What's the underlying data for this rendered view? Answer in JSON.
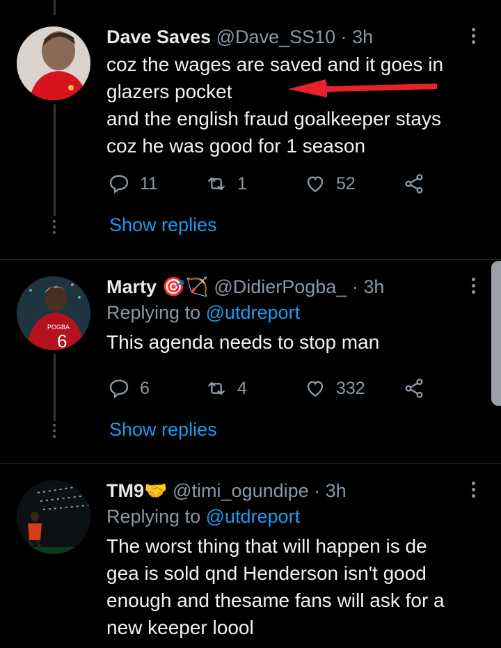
{
  "tweets": [
    {
      "name": "Dave Saves",
      "name_emoji": "",
      "handle": "@Dave_SS10 · 3h",
      "replying_prefix": "",
      "replying_mention": "",
      "text": "coz the wages are saved and it goes in\nglazers pocket\nand the english fraud goalkeeper stays\ncoz he was good for 1 season",
      "replies": "11",
      "retweets": "1",
      "likes": "52",
      "show_replies": "Show replies"
    },
    {
      "name": "Marty",
      "name_emoji": "🎯🏹",
      "handle": "@DidierPogba_ · 3h",
      "replying_prefix": "Replying to ",
      "replying_mention": "@utdreport",
      "text": "This agenda needs to stop man",
      "replies": "6",
      "retweets": "4",
      "likes": "332",
      "show_replies": "Show replies"
    },
    {
      "name": "TM9",
      "name_emoji": "🤝",
      "handle": "@timi_ogundipe · 3h",
      "replying_prefix": "Replying to ",
      "replying_mention": "@utdreport",
      "text": "The worst thing that will happen is de\ngea is sold qnd Henderson isn't good\nenough and thesame fans will ask for a\nnew keeper loool"
    }
  ],
  "avatars": {
    "tweet1": "goalkeeper-in-red-kit",
    "tweet2": "player-pogba-jersey-6",
    "tweet3": "player-in-stadium-lights"
  },
  "colors": {
    "background": "#000000",
    "accent_link": "#1d9bf0",
    "secondary_text": "#8b98a5",
    "annotation_arrow": "#e8222a"
  }
}
